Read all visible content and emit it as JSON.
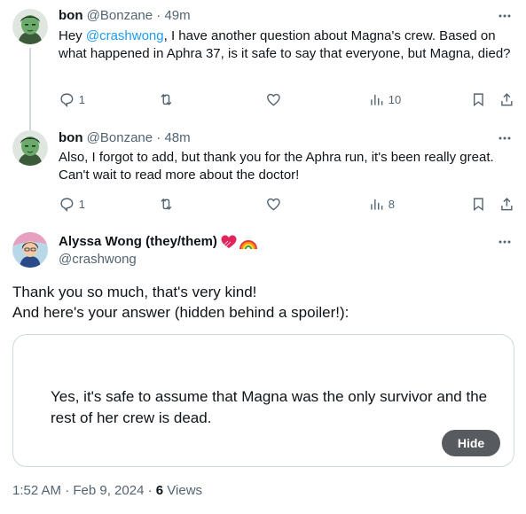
{
  "tweets": [
    {
      "name": "bon",
      "handle": "@Bonzane",
      "separator": "·",
      "time": "49m",
      "text_before": "Hey ",
      "mention": "@crashwong",
      "text_after": ", I have another question about Magna's crew. Based on what happened in Aphra 37, is it safe to say that everyone, but Magna, died?",
      "replies": "1",
      "views": "10"
    },
    {
      "name": "bon",
      "handle": "@Bonzane",
      "separator": "·",
      "time": "48m",
      "text": "Also, I forgot to add, but thank you for the Aphra run, it's been really great. Can't wait to read more about the doctor!",
      "replies": "1",
      "views": "8"
    }
  ],
  "main_tweet": {
    "name": "Alyssa Wong (they/them)",
    "handle": "@crashwong",
    "text_line1": "Thank you so much, that's very kind!",
    "text_line2": "And here's your answer (hidden behind a spoiler!):",
    "spoiler_text": "Yes, it's safe to assume that Magna was the only survivor and the rest of her crew is dead.",
    "hide_label": "Hide",
    "timestamp": "1:52 AM · Feb 9, 2024",
    "meta_separator": "·",
    "views_count": "6",
    "views_label": "Views"
  },
  "icons": [
    "more-icon",
    "reply-icon",
    "retweet-icon",
    "like-icon",
    "views-icon",
    "bookmark-icon",
    "share-icon",
    "heart-emoji-icon",
    "rainbow-emoji-icon"
  ],
  "colors": {
    "text": "#0f1419",
    "muted": "#536471",
    "link": "#1d9bf0",
    "thread_line": "#cfd9de",
    "hide_button": "#575a5e",
    "avatar_bon": "#5a9a5a",
    "heart": "#e0245e"
  }
}
